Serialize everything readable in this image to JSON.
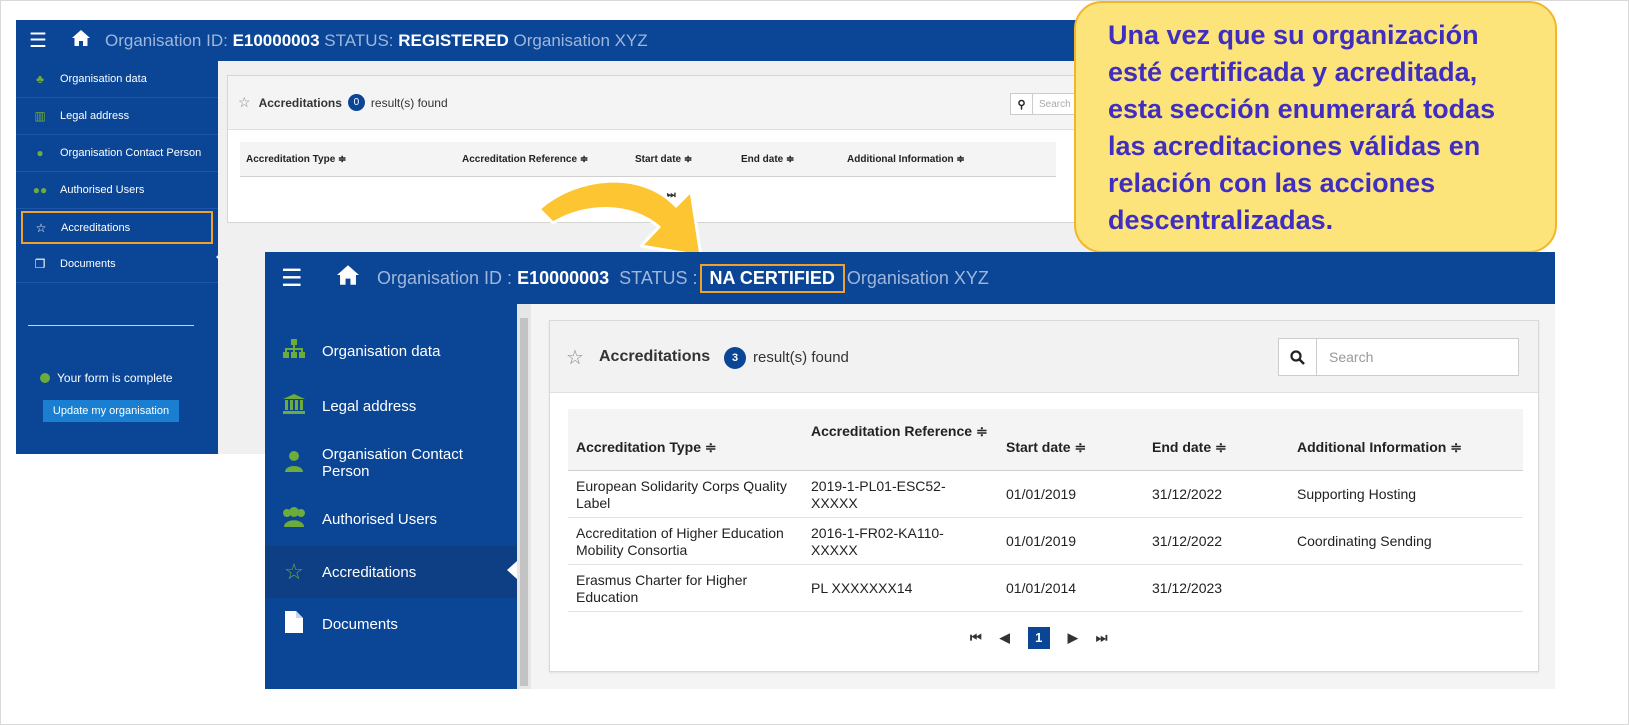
{
  "back": {
    "topbar": {
      "menu_icon": "☰",
      "home_icon": "home-icon",
      "org_id_label": "Organisation ID: ",
      "org_id_value": "E10000003",
      "status_label": " STATUS: ",
      "status_value": "REGISTERED",
      "org_name": " Organisation XYZ"
    },
    "sidebar": {
      "items": [
        {
          "label": "Organisation data",
          "icon": "sitemap-icon"
        },
        {
          "label": "Legal address",
          "icon": "bank-icon"
        },
        {
          "label": "Organisation Contact Person",
          "icon": "person-icon"
        },
        {
          "label": "Authorised Users",
          "icon": "users-icon"
        },
        {
          "label": "Accreditations",
          "icon": "star-icon"
        },
        {
          "label": "Documents",
          "icon": "document-icon"
        }
      ],
      "complete_text": "Your form is complete",
      "update_button": "Update my organisation"
    },
    "panel": {
      "title": "Accreditations",
      "count": "0",
      "found_text": "result(s) found",
      "search_placeholder": "Search",
      "columns": [
        "Accreditation Type ≑",
        "Accreditation Reference ≑",
        "Start date ≑",
        "End date ≑",
        "Additional Information ≑"
      ],
      "pager": [
        "⏮",
        "◀",
        "▶",
        "⏭"
      ]
    }
  },
  "callout": {
    "text": "Una vez que su organización esté certificada y acreditada, esta sección enumerará todas las acreditaciones válidas en relación con las acciones descentralizadas."
  },
  "front": {
    "topbar": {
      "menu_icon": "☰",
      "org_id_label": "Organisation ID : ",
      "org_id_value": "E10000003",
      "status_label": "  STATUS :",
      "status_value": "NA CERTIFIED",
      "org_name": "Organisation XYZ"
    },
    "sidebar": {
      "items": [
        {
          "label": "Organisation data",
          "icon": "sitemap-icon"
        },
        {
          "label": "Legal address",
          "icon": "bank-icon"
        },
        {
          "label": "Organisation Contact Person",
          "icon": "person-icon"
        },
        {
          "label": "Authorised Users",
          "icon": "users-icon"
        },
        {
          "label": "Accreditations",
          "icon": "star-icon"
        },
        {
          "label": "Documents",
          "icon": "document-icon"
        }
      ]
    },
    "panel": {
      "title": "Accreditations",
      "count": "3",
      "found_text": "result(s) found",
      "search_placeholder": "Search",
      "columns": {
        "type": "Accreditation Type ≑",
        "reference": "Accreditation Reference ≑",
        "start": "Start date ≑",
        "end": "End date ≑",
        "info": "Additional Information ≑"
      },
      "rows": [
        {
          "type": "European Solidarity Corps Quality Label",
          "reference": "2019-1-PL01-ESC52-XXXXX",
          "start": "01/01/2019",
          "end": "31/12/2022",
          "info": "Supporting Hosting"
        },
        {
          "type": "Accreditation of Higher Education Mobility Consortia",
          "reference": "2016-1-FR02-KA110-XXXXX",
          "start": "01/01/2019",
          "end": "31/12/2022",
          "info": "Coordinating Sending"
        },
        {
          "type": "Erasmus Charter for Higher Education",
          "reference": "PL XXXXXXX14",
          "start": "01/01/2014",
          "end": "31/12/2023",
          "info": ""
        }
      ],
      "pager": {
        "first": "⏮",
        "prev": "◀",
        "current": "1",
        "next": "▶",
        "last": "⏭"
      }
    }
  },
  "colors": {
    "brand_blue": "#0a4596",
    "accent_orange": "#f0a12b",
    "callout_fill": "#fde47a",
    "callout_text": "#3f2ec0",
    "icon_green": "#6cab3c"
  }
}
